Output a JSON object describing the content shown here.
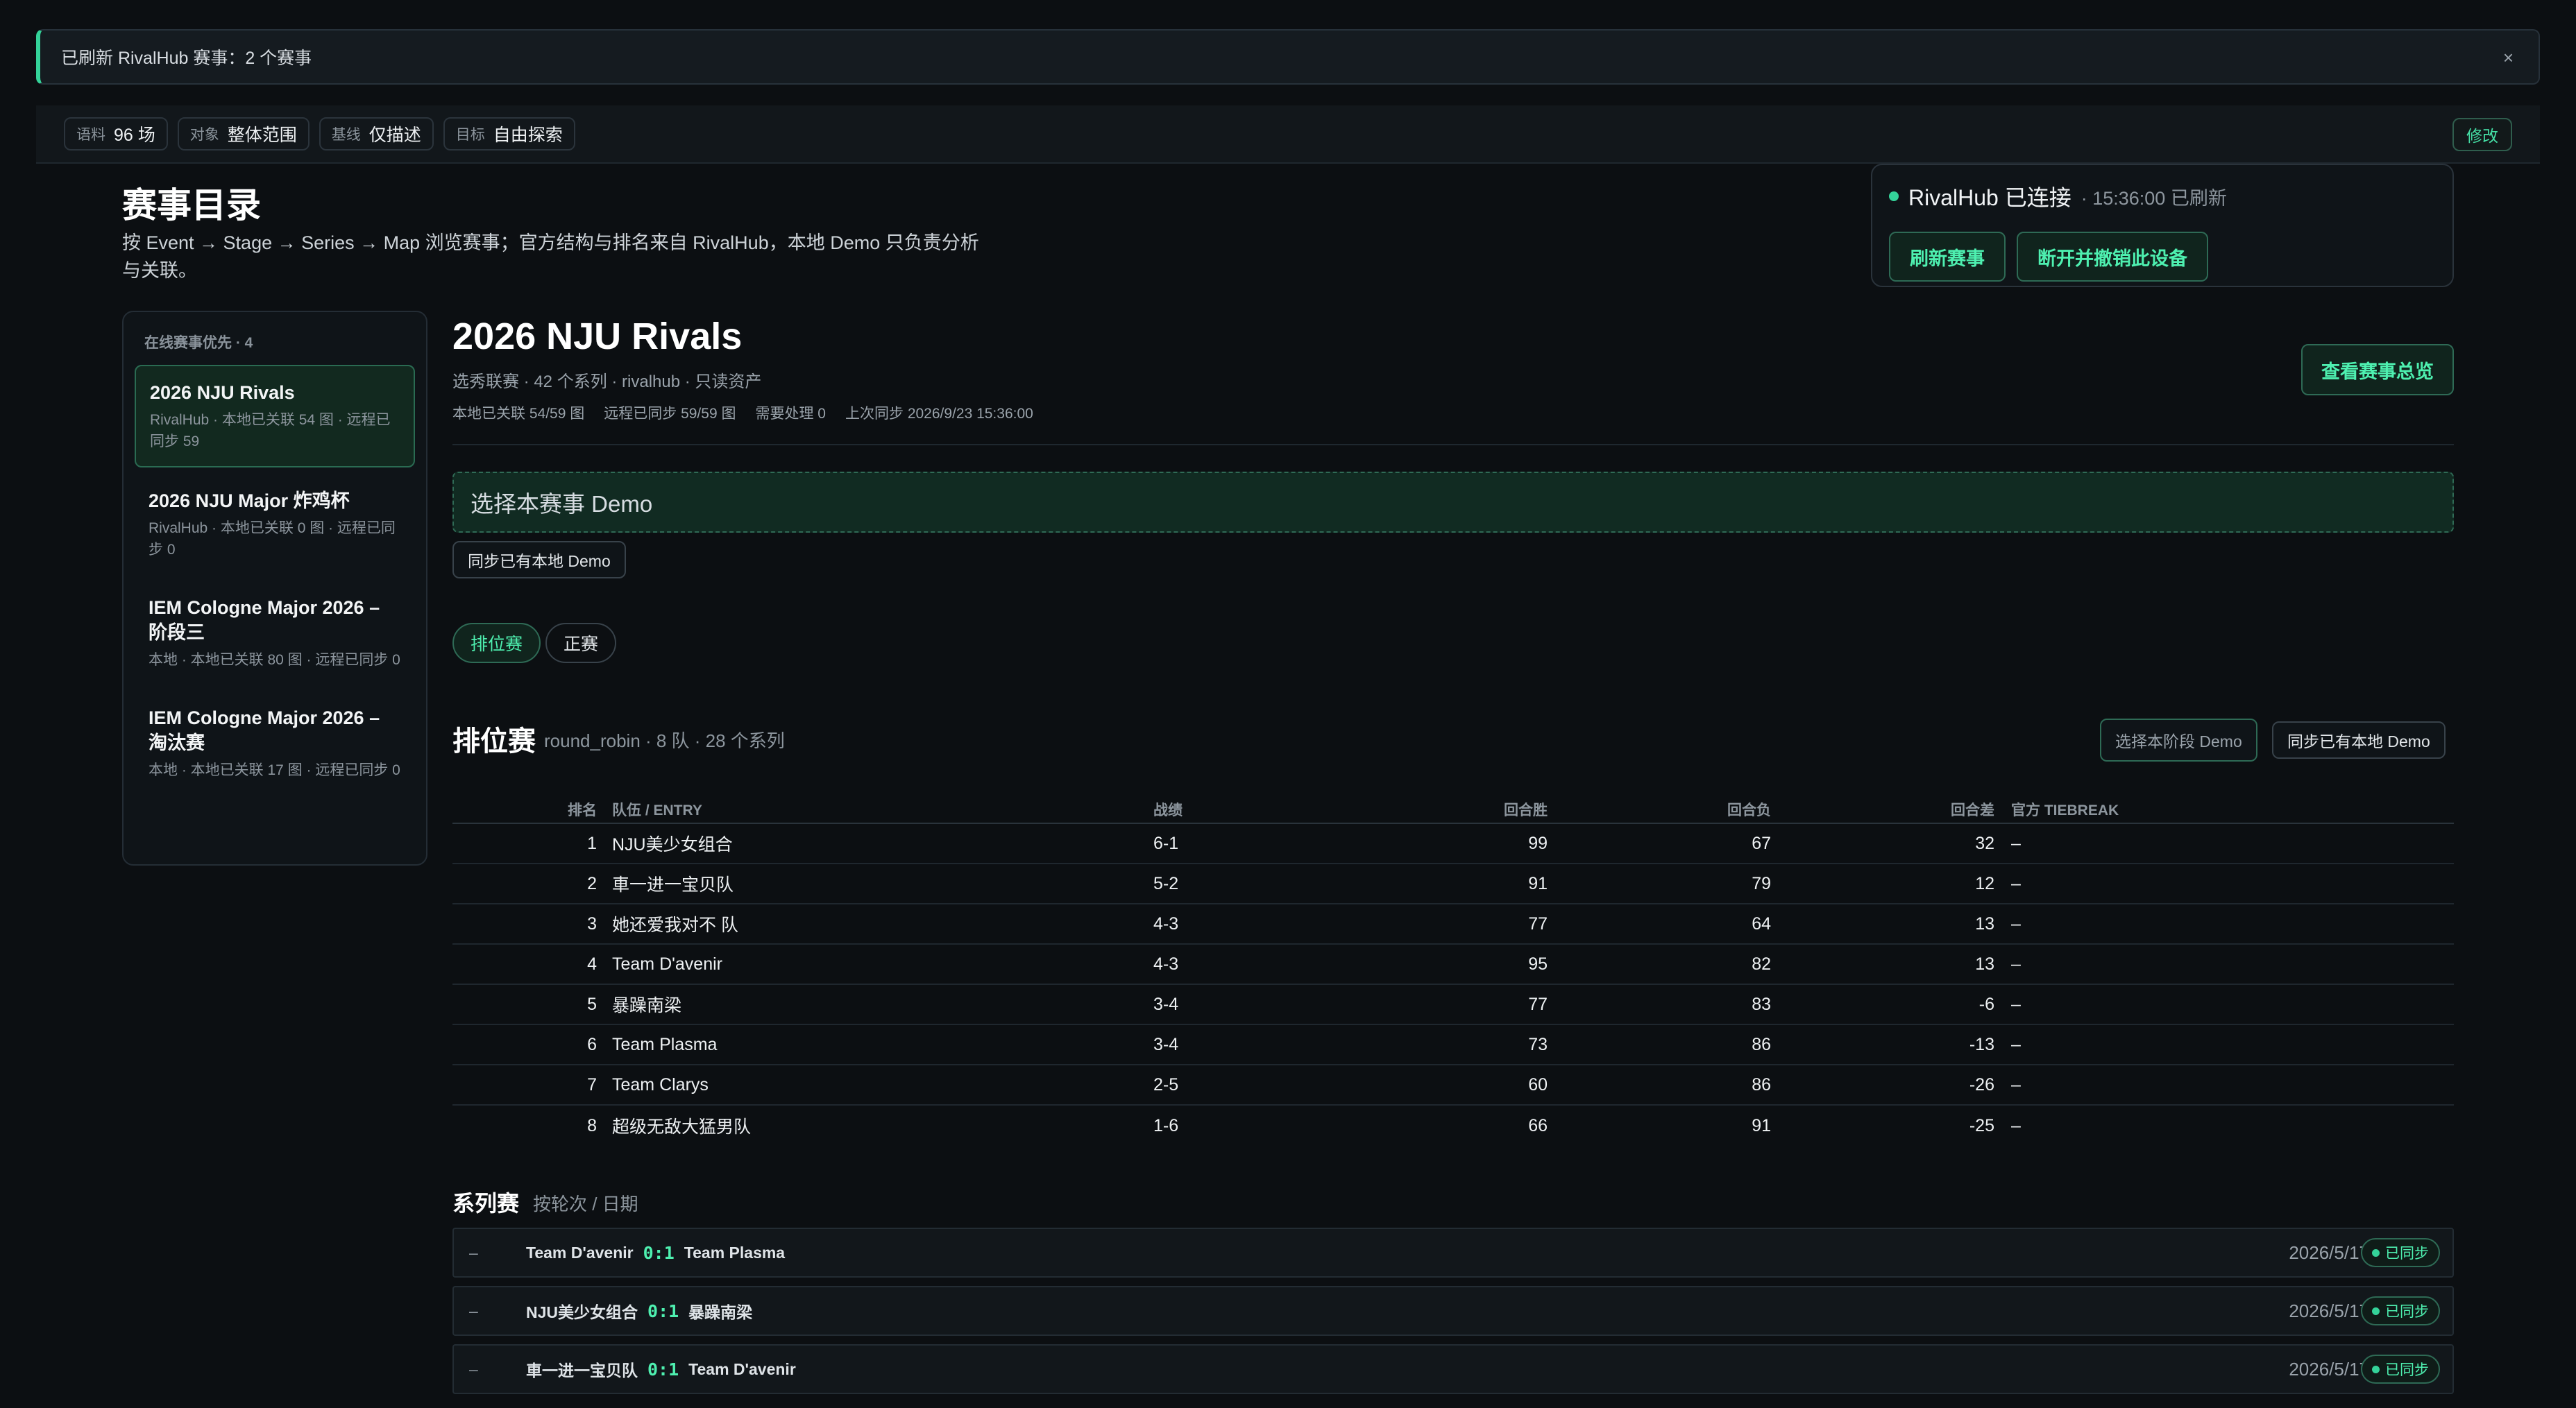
{
  "toast": {
    "text": "已刷新 RivalHub 赛事：2 个赛事",
    "close": "×"
  },
  "filters": [
    {
      "key": "语料",
      "value": "96 场"
    },
    {
      "key": "对象",
      "value": "整体范围"
    },
    {
      "key": "基线",
      "value": "仅描述"
    },
    {
      "key": "目标",
      "value": "自由探索"
    }
  ],
  "edit_label": "修改",
  "page": {
    "title": "赛事目录",
    "desc": "按 Event → Stage → Series → Map 浏览赛事；官方结构与排名来自 RivalHub，本地 Demo 只负责分析与关联。"
  },
  "connection": {
    "status": "RivalHub 已连接",
    "refreshed": "· 15:36:00 已刷新",
    "refresh_btn": "刷新赛事",
    "disconnect_btn": "断开并撤销此设备"
  },
  "sidebar": {
    "header": "在线赛事优先 · 4",
    "events": [
      {
        "title": "2026 NJU Rivals",
        "detail": "RivalHub · 本地已关联 54 图 · 远程已同步 59"
      },
      {
        "title": "2026 NJU Major 炸鸡杯",
        "detail": "RivalHub · 本地已关联 0 图 · 远程已同步 0"
      },
      {
        "title": "IEM Cologne Major 2026 – 阶段三",
        "detail": "本地 · 本地已关联 80 图 · 远程已同步 0"
      },
      {
        "title": "IEM Cologne Major 2026 – 淘汰赛",
        "detail": "本地 · 本地已关联 17 图 · 远程已同步 0"
      }
    ]
  },
  "event": {
    "title": "2026 NJU Rivals",
    "subtitle": "选秀联赛 · 42 个系列 · rivalhub · 只读资产",
    "meta": [
      "本地已关联 54/59 图",
      "远程已同步 59/59 图",
      "需要处理 0",
      "上次同步 2026/9/23 15:36:00"
    ],
    "overview_btn": "查看赛事总览",
    "demo_drop": "选择本赛事 Demo",
    "sync_btn": "同步已有本地 Demo"
  },
  "stage_tabs": [
    "排位赛",
    "正赛"
  ],
  "stage": {
    "title": "排位赛",
    "subtitle": "round_robin · 8 队 · 28 个系列",
    "select_btn": "选择本阶段 Demo",
    "sync_btn": "同步已有本地 Demo"
  },
  "table": {
    "headers": [
      "排名",
      "队伍 / ENTRY",
      "战绩",
      "回合胜",
      "回合负",
      "回合差",
      "官方 TIEBREAK"
    ],
    "rows": [
      [
        "1",
        "NJU美少女组合",
        "6-1",
        "99",
        "67",
        "32",
        "–"
      ],
      [
        "2",
        "車一进一宝贝队",
        "5-2",
        "91",
        "79",
        "12",
        "–"
      ],
      [
        "3",
        "她还爱我对不 队",
        "4-3",
        "77",
        "64",
        "13",
        "–"
      ],
      [
        "4",
        "Team D'avenir",
        "4-3",
        "95",
        "82",
        "13",
        "–"
      ],
      [
        "5",
        "暴躁南梁",
        "3-4",
        "77",
        "83",
        "-6",
        "–"
      ],
      [
        "6",
        "Team Plasma",
        "3-4",
        "73",
        "86",
        "-13",
        "–"
      ],
      [
        "7",
        "Team Clarys",
        "2-5",
        "60",
        "86",
        "-26",
        "–"
      ],
      [
        "8",
        "超级无敌大猛男队",
        "1-6",
        "66",
        "91",
        "-25",
        "–"
      ]
    ]
  },
  "series": {
    "title": "系列赛",
    "subtitle": "按轮次 / 日期",
    "rows": [
      {
        "dash": "–",
        "teamA": "Team D'avenir",
        "score": "0:1",
        "teamB": "Team Plasma",
        "date": "2026/5/17",
        "status": "已同步"
      },
      {
        "dash": "–",
        "teamA": "NJU美少女组合",
        "score": "0:1",
        "teamB": "暴躁南梁",
        "date": "2026/5/17",
        "status": "已同步"
      },
      {
        "dash": "–",
        "teamA": "車一进一宝贝队",
        "score": "0:1",
        "teamB": "Team D'avenir",
        "date": "2026/5/17",
        "status": "已同步"
      }
    ]
  }
}
